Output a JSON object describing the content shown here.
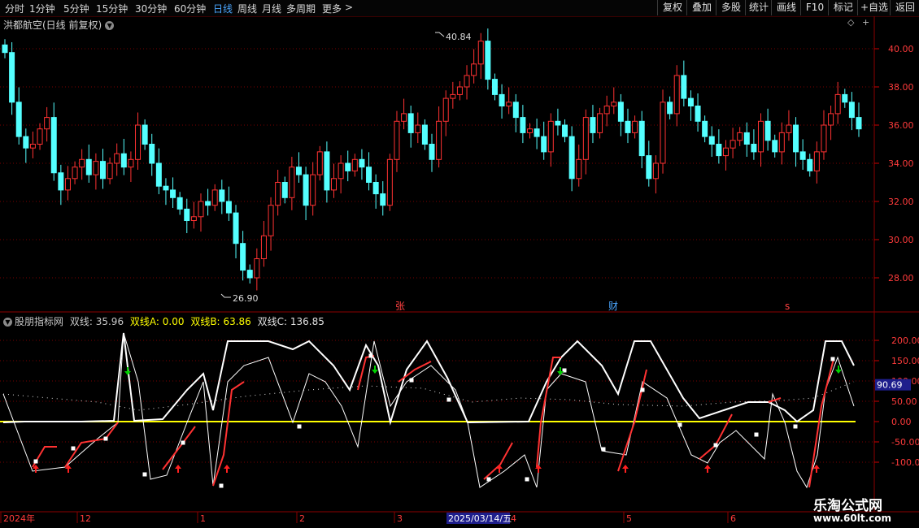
{
  "toolbar": {
    "periods": [
      "分时",
      "1分钟",
      "5分钟",
      "15分钟",
      "30分钟",
      "60分钟",
      "日线",
      "周线",
      "月线",
      "多周期",
      "更多"
    ],
    "active_period": "日线",
    "more_chevron": ">",
    "right_buttons": [
      "复权",
      "叠加",
      "多股",
      "统计",
      "画线",
      "F10",
      "标记",
      "+自选",
      "返回"
    ]
  },
  "stock": {
    "title": "洪都航空(日线 前复权)",
    "high_label": "40.84",
    "low_label": "26.90"
  },
  "price_axis": [
    "40.00",
    "38.00",
    "36.00",
    "34.00",
    "32.00",
    "30.00",
    "28.00"
  ],
  "markers": {
    "zhang": "张",
    "cai": "财",
    "s": "s"
  },
  "indicator": {
    "name": "股朋指标网",
    "items": [
      {
        "label": "双线:",
        "value": "35.96",
        "color": "#e0e0e0"
      },
      {
        "label": "双线A:",
        "value": "0.00",
        "color": "#ffff00"
      },
      {
        "label": "双线B:",
        "value": "63.86",
        "color": "#ffff00"
      },
      {
        "label": "双线C:",
        "value": "136.85",
        "color": "#e0e0e0"
      }
    ],
    "axis": [
      "200.00",
      "150.00",
      "100.00",
      "50.00",
      "0.00",
      "-50.00",
      "-100.00"
    ],
    "current_value": "90.69"
  },
  "date_axis": {
    "labels": [
      "2024年",
      "12",
      "1",
      "2",
      "3",
      "4",
      "5",
      "6"
    ],
    "cursor_date": "2025/03/14/五"
  },
  "watermark": {
    "line1": "乐淘公式网",
    "line2": "www.60lt.com"
  },
  "colors": {
    "up": "#ff3232",
    "down": "#54ffff",
    "grid": "#7a0000",
    "white_line": "#ffffff",
    "zero_line": "#ffff00",
    "arrow_up": "#ff2020",
    "arrow_down": "#00d000"
  }
}
